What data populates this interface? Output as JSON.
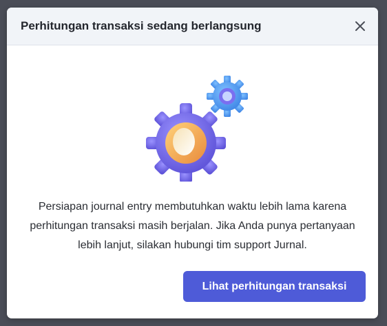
{
  "dialog": {
    "title": "Perhitungan transaksi sedang berlangsung",
    "close_icon": "close-icon",
    "illustration_icon": "gears-icon",
    "message": "Persiapan journal entry membutuhkan waktu lebih lama karena perhitungan transaksi masih berjalan. Jika Anda punya pertanyaan lebih lanjut, silakan hubungi tim support Jurnal.",
    "primary_button_label": "Lihat perhitungan transaksi"
  },
  "colors": {
    "overlay": "#4a4d57",
    "header_bg": "#f1f4f8",
    "primary": "#4e5bd8",
    "gear_large": "#7b72f0",
    "gear_small": "#5fa8f5",
    "ring": "#f3b45a"
  }
}
